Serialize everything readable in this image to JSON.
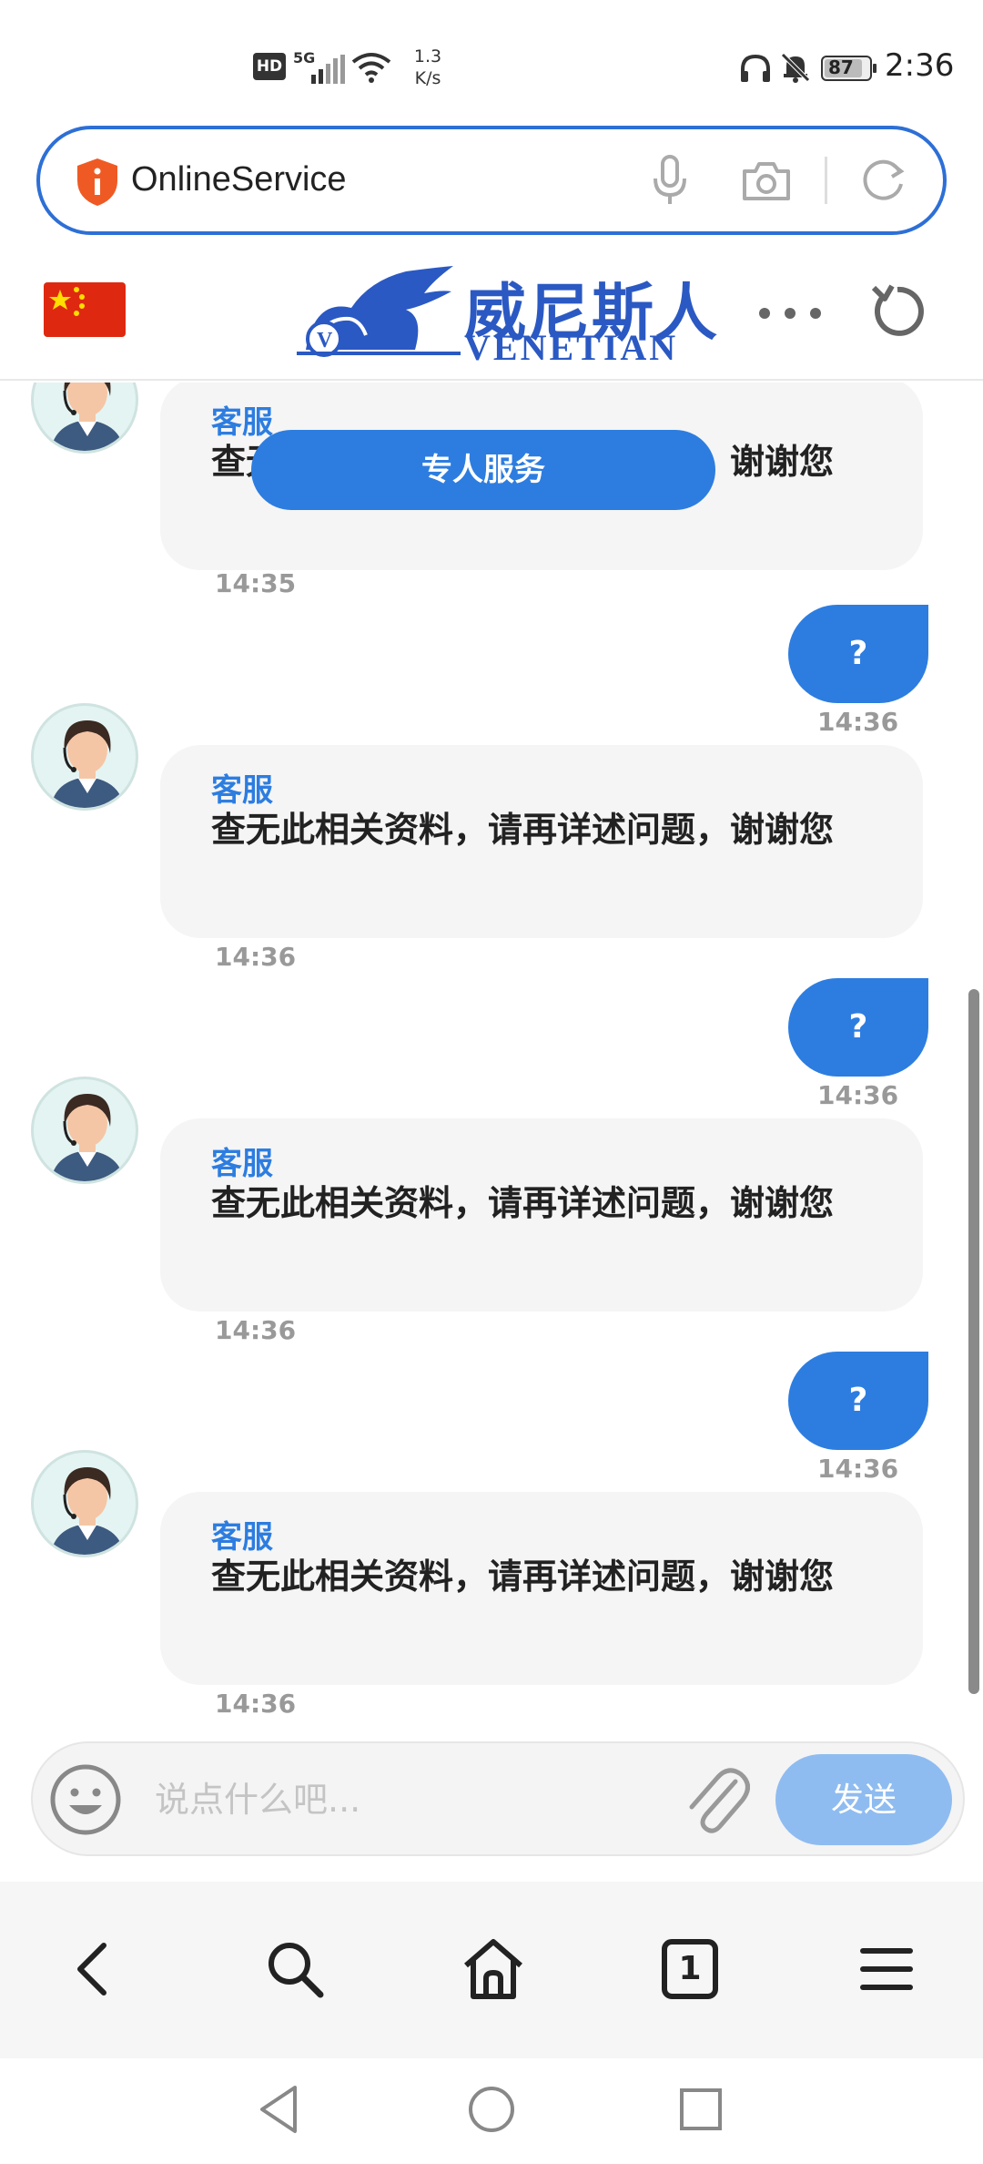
{
  "status_bar": {
    "hd": "HD",
    "network": "5G",
    "speed_value": "1.3",
    "speed_unit": "K/s",
    "battery": "87",
    "time": "2:36"
  },
  "url_bar": {
    "url": "OnlineService"
  },
  "site_header": {
    "logo_cn": "威尼斯人",
    "logo_en": "VENETIAN"
  },
  "chat": {
    "service_button": "专人服务",
    "messages": [
      {
        "from": "agent",
        "name": "客服",
        "text": "查无此相关资料，请再详述问题，谢谢您",
        "time": "14:35"
      },
      {
        "from": "user",
        "text": "?",
        "time": "14:36"
      },
      {
        "from": "agent",
        "name": "客服",
        "text": "查无此相关资料，请再详述问题，谢谢您",
        "time": "14:36"
      },
      {
        "from": "user",
        "text": "?",
        "time": "14:36"
      },
      {
        "from": "agent",
        "name": "客服",
        "text": "查无此相关资料，请再详述问题，谢谢您",
        "time": "14:36"
      },
      {
        "from": "user",
        "text": "?",
        "time": "14:36"
      },
      {
        "from": "agent",
        "name": "客服",
        "text": "查无此相关资料，请再详述问题，谢谢您",
        "time": "14:36"
      }
    ]
  },
  "input_bar": {
    "placeholder": "说点什么吧...",
    "send_label": "发送"
  },
  "browser_nav": {
    "tab_count": "1"
  },
  "colors": {
    "accent": "#2d7de0",
    "send_disabled": "#8fbcf0",
    "logo_blue": "#2b59c3"
  }
}
